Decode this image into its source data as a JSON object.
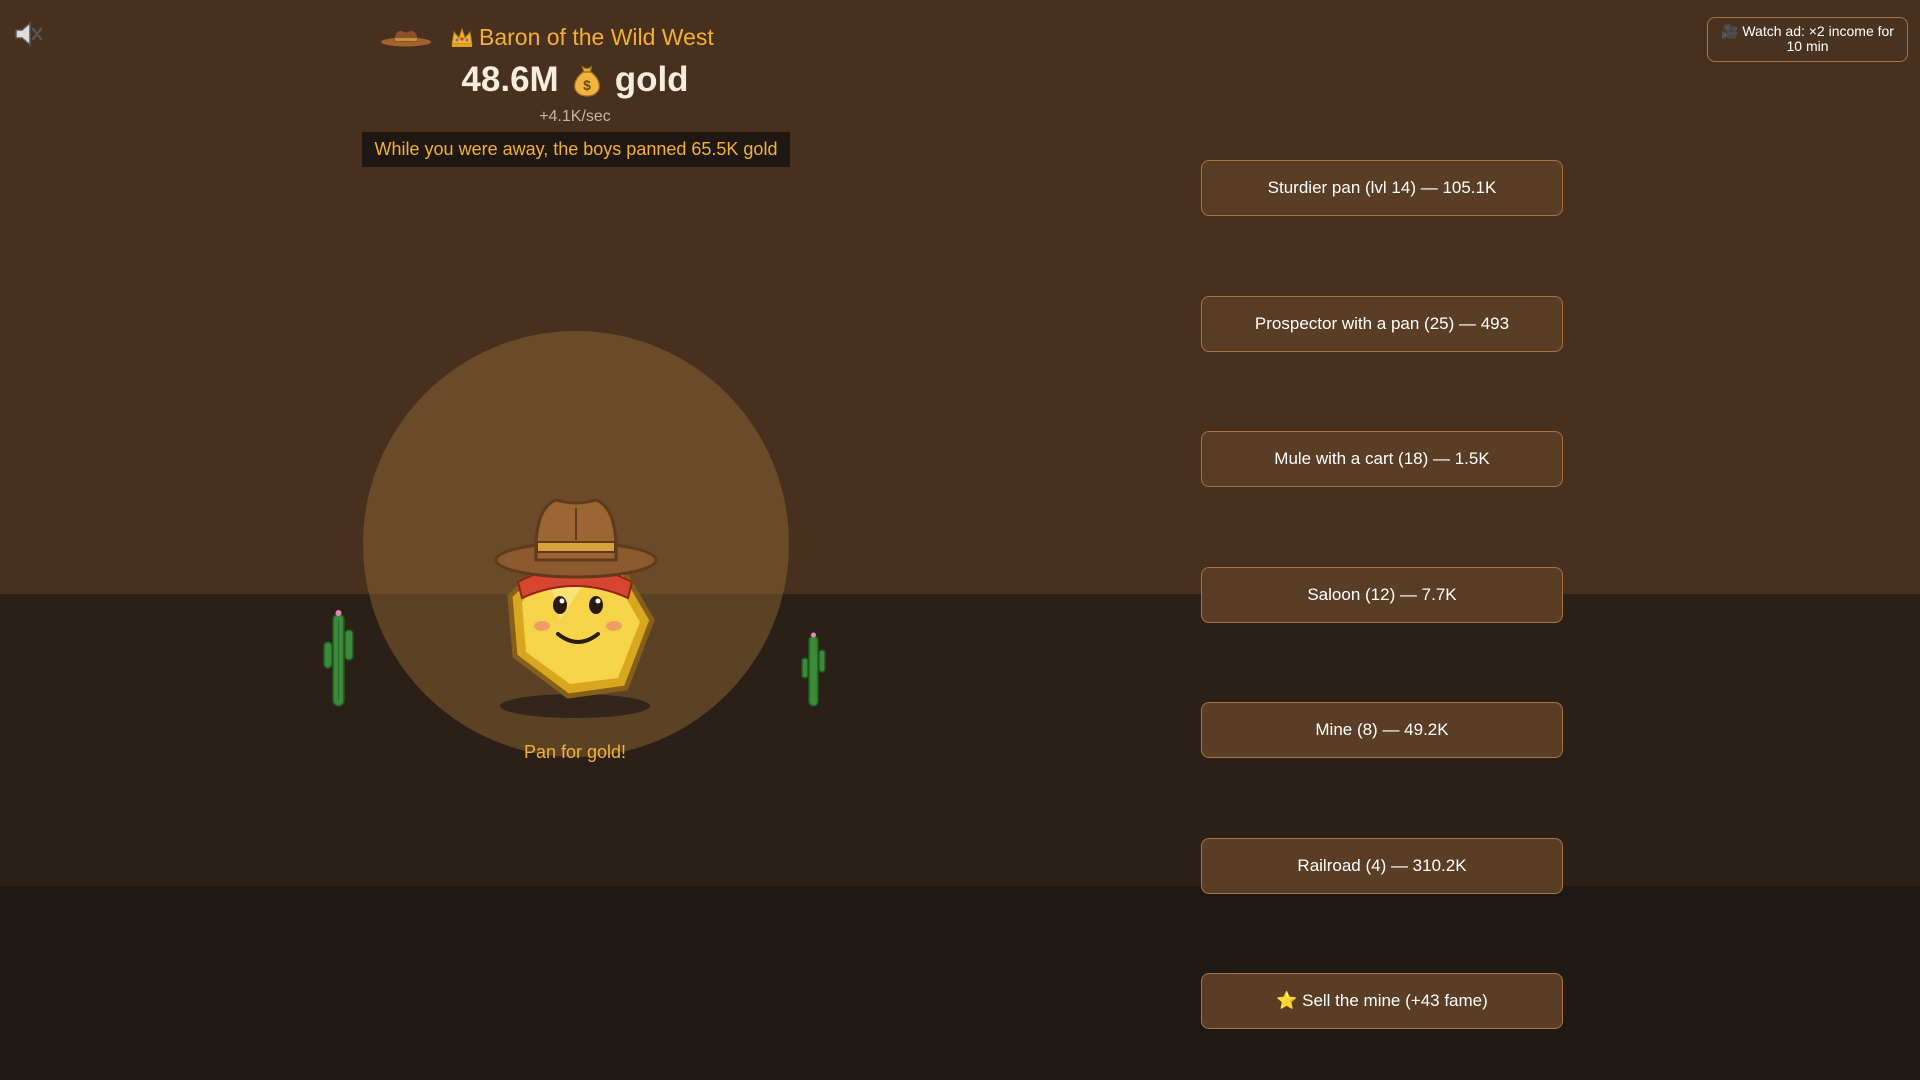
{
  "header": {
    "title": "Baron of the Wild West",
    "title_icons": [
      "cowboy-hat-icon",
      "crown-icon"
    ],
    "gold_amount": "48.6M",
    "gold_unit": "gold",
    "rate": "+4.1K/sec",
    "away_message": "While you were away, the boys panned 65.5K gold"
  },
  "ad_button": {
    "icon": "camera-icon",
    "label": "Watch ad: ×2 income for 10 min"
  },
  "sound": {
    "icon": "speaker-muted-icon"
  },
  "pan": {
    "label": "Pan for gold!"
  },
  "upgrades": [
    {
      "label": "Sturdier pan (lvl 14) — 105.1K"
    },
    {
      "label": "Prospector with a pan (25) — 493"
    },
    {
      "label": "Mule with a cart (18) — 1.5K"
    },
    {
      "label": "Saloon (12) — 7.7K"
    },
    {
      "label": "Mine (8) — 49.2K"
    },
    {
      "label": "Railroad (4) — 310.2K"
    },
    {
      "label": "⭐ Sell the mine (+43 fame)"
    }
  ],
  "colors": {
    "sky": "#48301f",
    "ground": "#2b2018",
    "accent": "#f3b032",
    "button_bg": "#5a3d25",
    "button_border": "#a9743f"
  }
}
